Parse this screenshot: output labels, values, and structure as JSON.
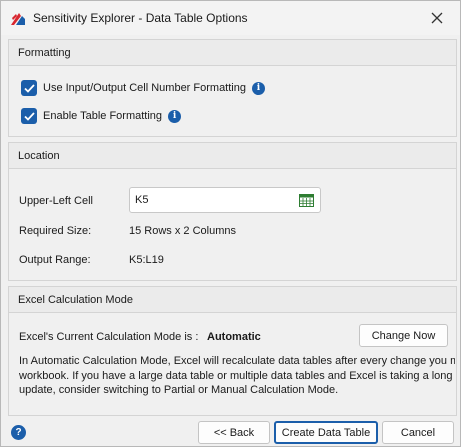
{
  "window": {
    "title": "Sensitivity Explorer - Data Table Options"
  },
  "formatting": {
    "header": "Formatting",
    "use_io_formatting": {
      "label": "Use Input/Output Cell Number Formatting",
      "checked": true
    },
    "enable_table_formatting": {
      "label": "Enable Table Formatting",
      "checked": true
    }
  },
  "location": {
    "header": "Location",
    "upper_left_label": "Upper-Left Cell",
    "upper_left_value": "K5",
    "required_size_label": "Required Size:",
    "required_size_value": "15 Rows x 2 Columns",
    "output_range_label": "Output Range:",
    "output_range_value": "K5:L19"
  },
  "calc_mode": {
    "header": "Excel Calculation Mode",
    "current_label": "Excel's Current Calculation Mode is :",
    "current_value": "Automatic",
    "change_button": "Change Now",
    "description_lines": [
      "In Automatic Calculation Mode, Excel will recalculate data tables after every change you ma",
      "workbook.  If you have a large data table or multiple data tables and Excel is taking a long t",
      "update, consider switching to Partial or Manual Calculation Mode."
    ]
  },
  "footer": {
    "help": "?",
    "back": "<< Back",
    "create": "Create Data Table",
    "cancel": "Cancel"
  },
  "colors": {
    "accent": "#1b5eaa",
    "logo_red": "#d8262f",
    "logo_blue": "#1b5eaa"
  },
  "icons": [
    "app-logo-icon",
    "close-icon",
    "checkmark-icon",
    "info-icon",
    "calendar-grid-icon",
    "help-icon"
  ]
}
